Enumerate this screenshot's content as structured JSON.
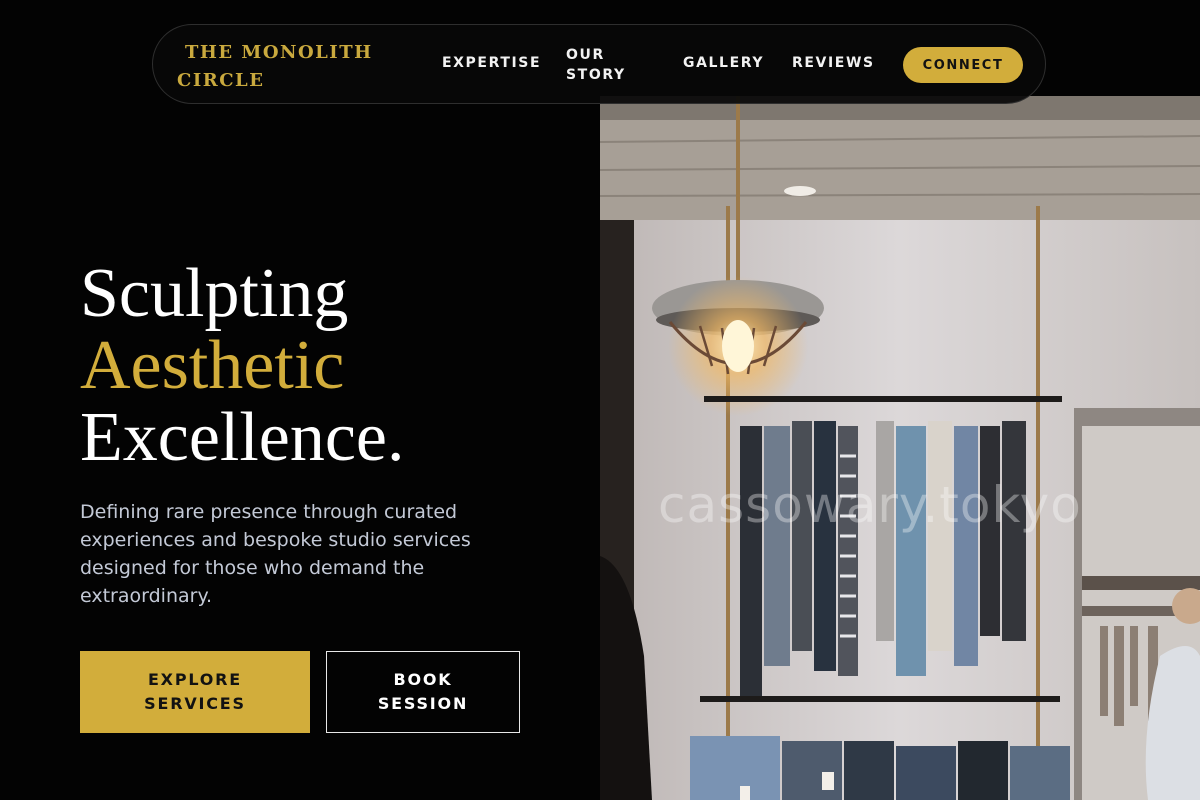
{
  "brand": {
    "name": "THE MONOLITH CIRCLE"
  },
  "nav": {
    "links": [
      {
        "label": "EXPERTISE"
      },
      {
        "label": "OUR STORY"
      },
      {
        "label": "GALLERY"
      },
      {
        "label": "REVIEWS"
      }
    ],
    "cta_label": "CONNECT"
  },
  "hero": {
    "headline_line1": "Sculpting",
    "headline_line2": "Aesthetic",
    "headline_line3": "Excellence.",
    "subtext": "Defining rare presence through curated experiences and bespoke studio services designed for those who demand the extraordinary.",
    "primary_button": "EXPLORE SERVICES",
    "secondary_button": "BOOK SESSION",
    "image_watermark": "cassowary.tokyo"
  },
  "colors": {
    "accent_gold": "#d2ad3b",
    "background": "#030303",
    "text_light": "#ffffff",
    "text_muted": "#c3c9d6"
  }
}
